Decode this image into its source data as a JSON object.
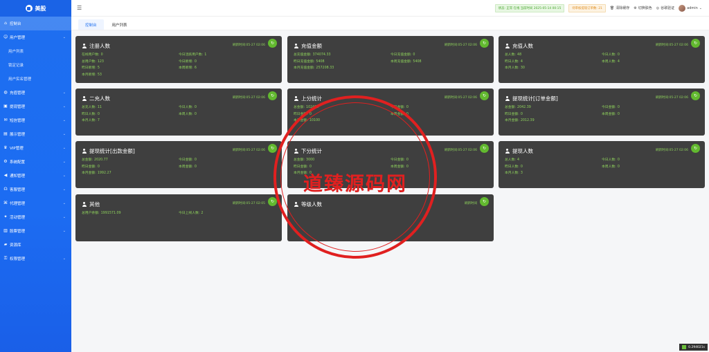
{
  "brand": {
    "name": "美股"
  },
  "sidebar": {
    "items": [
      {
        "label": "控制台",
        "icon": "home-icon",
        "active": true,
        "chevron": false,
        "sub": false
      },
      {
        "label": "用户管理",
        "icon": "user-icon",
        "active": false,
        "chevron": true,
        "sub": false
      },
      {
        "label": "用户列表",
        "icon": "",
        "active": false,
        "chevron": false,
        "sub": true
      },
      {
        "label": "锁定记录",
        "icon": "",
        "active": false,
        "chevron": false,
        "sub": true
      },
      {
        "label": "用户实名管理",
        "icon": "",
        "active": false,
        "chevron": false,
        "sub": true
      },
      {
        "label": "充值管理",
        "icon": "coin-icon",
        "active": false,
        "chevron": true,
        "sub": false
      },
      {
        "label": "提现管理",
        "icon": "wallet-icon",
        "active": false,
        "chevron": true,
        "sub": false
      },
      {
        "label": "短信管理",
        "icon": "mail-icon",
        "active": false,
        "chevron": true,
        "sub": false
      },
      {
        "label": "展示管理",
        "icon": "display-icon",
        "active": false,
        "chevron": true,
        "sub": false
      },
      {
        "label": "VIP管理",
        "icon": "crown-icon",
        "active": false,
        "chevron": true,
        "sub": false
      },
      {
        "label": "系统配置",
        "icon": "gear-icon",
        "active": false,
        "chevron": true,
        "sub": false
      },
      {
        "label": "通知管理",
        "icon": "megaphone-icon",
        "active": false,
        "chevron": true,
        "sub": false
      },
      {
        "label": "客服管理",
        "icon": "headset-icon",
        "active": false,
        "chevron": true,
        "sub": false
      },
      {
        "label": "代理管理",
        "icon": "network-icon",
        "active": false,
        "chevron": true,
        "sub": false
      },
      {
        "label": "活动管理",
        "icon": "gift-icon",
        "active": false,
        "chevron": true,
        "sub": false
      },
      {
        "label": "股票管理",
        "icon": "chart-icon",
        "active": false,
        "chevron": true,
        "sub": false
      },
      {
        "label": "资源库",
        "icon": "folder-icon",
        "active": false,
        "chevron": false,
        "sub": false
      },
      {
        "label": "权限管理",
        "icon": "lock-icon",
        "active": false,
        "chevron": true,
        "sub": false
      }
    ]
  },
  "header": {
    "status_badge": "状态: 正常 在线 当前时间 2025-05-14 00:15",
    "warn_badge": "待审核提现订单数: 21",
    "clear_cache": "清除缓存",
    "switch_theme": "切换肤色",
    "verify": "谷歌验证",
    "user": "admin"
  },
  "tabs": [
    {
      "label": "控制台",
      "active": true
    },
    {
      "label": "用户列表",
      "active": false
    }
  ],
  "cards": [
    {
      "title": "注册人数",
      "time": "刷新时间:05-27 02:06",
      "stats": [
        [
          "在线用户数:",
          "0"
        ],
        [
          "今日活跃用户数:",
          "1"
        ],
        [
          "总用户数:",
          "123"
        ],
        [
          "今日新增:",
          "0"
        ],
        [
          "昨日新增:",
          "5"
        ],
        [
          "本周新增:",
          "6"
        ],
        [
          "本月新增:",
          "53"
        ]
      ]
    },
    {
      "title": "充值金额",
      "time": "刷新时间:05-27 02:06",
      "stats": [
        [
          "总充值金额:",
          "374074.33"
        ],
        [
          "今日充值金额:",
          "0"
        ],
        [
          "昨日充值金额:",
          "5408"
        ],
        [
          "本周充值金额:",
          "5408"
        ],
        [
          "本月充值金额:",
          "257208.33"
        ]
      ]
    },
    {
      "title": "充值人数",
      "time": "刷新时间:05-27 02:06",
      "stats": [
        [
          "总人数:",
          "48"
        ],
        [
          "今日人数:",
          "0"
        ],
        [
          "昨日人数:",
          "4"
        ],
        [
          "本周人数:",
          "4"
        ],
        [
          "本月人数:",
          "30"
        ]
      ]
    },
    {
      "title": "二充人数",
      "time": "刷新时间:05-27 02:06",
      "stats": [
        [
          "总充人数:",
          "11"
        ],
        [
          "今日人数:",
          "0"
        ],
        [
          "昨日人数:",
          "0"
        ],
        [
          "本周人数:",
          "0"
        ],
        [
          "本月人数:",
          "7"
        ]
      ]
    },
    {
      "title": "上分统计",
      "time": "刷新时间:05-27 02:06",
      "stats": [
        [
          "总金额:",
          "102400"
        ],
        [
          "今日金额:",
          "0"
        ],
        [
          "昨日金额:",
          "0"
        ],
        [
          "本周金额:",
          "0"
        ],
        [
          "本月金额:",
          "10100"
        ]
      ]
    },
    {
      "title": "提现统计[订单金额]",
      "time": "刷新时间:05-27 02:06",
      "stats": [
        [
          "总金额:",
          "2042.39"
        ],
        [
          "今日金额:",
          "0"
        ],
        [
          "昨日金额:",
          "0"
        ],
        [
          "本周金额:",
          "0"
        ],
        [
          "本月金额:",
          "2012.39"
        ]
      ]
    },
    {
      "title": "提现统计[出款金额]",
      "time": "刷新时间:05-27 02:06",
      "stats": [
        [
          "总金额:",
          "2020.77"
        ],
        [
          "今日金额:",
          "0"
        ],
        [
          "昨日金额:",
          "0"
        ],
        [
          "本周金额:",
          "0"
        ],
        [
          "本月金额:",
          "1992.27"
        ]
      ]
    },
    {
      "title": "下分统计",
      "time": "刷新时间:05-27 02:06",
      "stats": [
        [
          "总金额:",
          "3000"
        ],
        [
          "今日金额:",
          "0"
        ],
        [
          "昨日金额:",
          "0"
        ],
        [
          "本周金额:",
          "0"
        ],
        [
          "本月金额:",
          "0"
        ]
      ]
    },
    {
      "title": "提现人数",
      "time": "刷新时间:05-27 02:06",
      "stats": [
        [
          "总人数:",
          "4"
        ],
        [
          "今日人数:",
          "0"
        ],
        [
          "昨日人数:",
          "0"
        ],
        [
          "本周人数:",
          "0"
        ],
        [
          "本月人数:",
          "3"
        ]
      ]
    },
    {
      "title": "其他",
      "time": "刷新时间:05-27 02:05",
      "stats": [
        [
          "总用户余额:",
          "1991571.09"
        ],
        [
          "今日上线人数:",
          "2"
        ]
      ]
    },
    {
      "title": "等级人数",
      "time": "刷新时间",
      "stats": []
    }
  ],
  "footer": {
    "speed": "0.294021s"
  },
  "watermark": {
    "text": "道臻源码网",
    "url": "www.dzym.com"
  },
  "colors": {
    "sidebar": "#1e6ff0",
    "card": "#3f3f3f",
    "stat_green": "#8fd35c",
    "refresh": "#62b92f",
    "watermark": "#e02020"
  }
}
